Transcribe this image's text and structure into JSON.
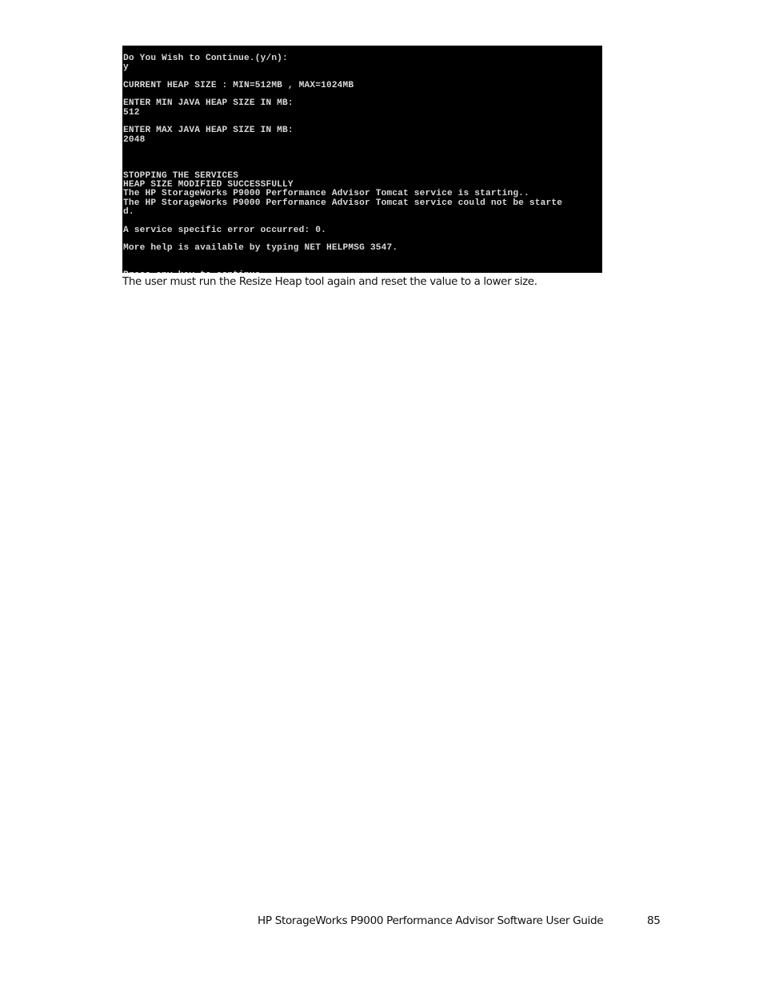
{
  "console": {
    "lines": [
      "Do You Wish to Continue.(y/n):",
      "y",
      "",
      "CURRENT HEAP SIZE : MIN=512MB , MAX=1024MB",
      "",
      "ENTER MIN JAVA HEAP SIZE IN MB:",
      "512",
      "",
      "ENTER MAX JAVA HEAP SIZE IN MB:",
      "2048",
      "",
      "",
      "",
      "STOPPING THE SERVICES",
      "HEAP SIZE MODIFIED SUCCESSFULLY",
      "The HP StorageWorks P9000 Performance Advisor Tomcat service is starting..",
      "The HP StorageWorks P9000 Performance Advisor Tomcat service could not be starte",
      "d.",
      "",
      "A service specific error occurred: 0.",
      "",
      "More help is available by typing NET HELPMSG 3547.",
      "",
      "",
      "Press any key to continue . . . "
    ]
  },
  "body": {
    "caption": "The user must run the Resize Heap tool again and reset the value to a lower size."
  },
  "footer": {
    "title": "HP StorageWorks P9000 Performance Advisor Software User Guide",
    "page_number": "85"
  }
}
